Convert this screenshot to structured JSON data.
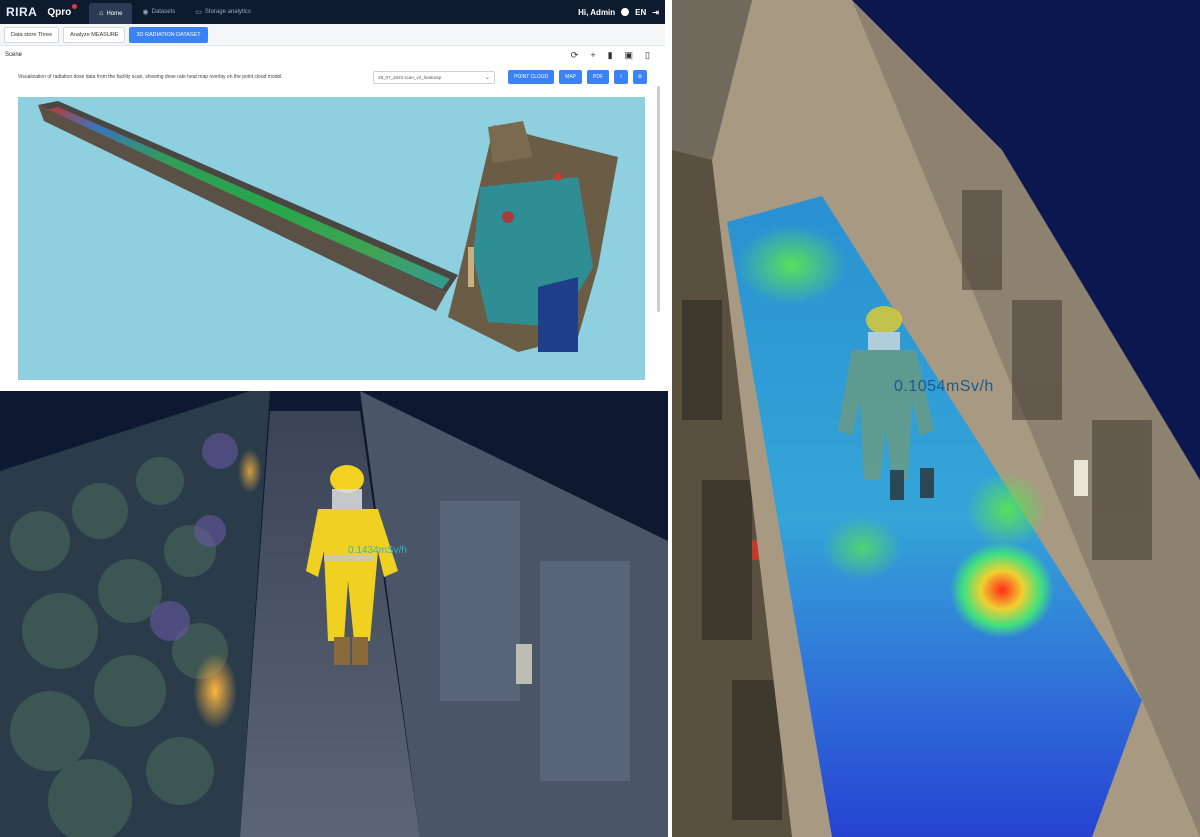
{
  "app": {
    "logo": "RIRA",
    "logo2": "Qpro",
    "nav": [
      {
        "icon": "home-icon",
        "label": "Home"
      },
      {
        "icon": "database-icon",
        "label": "Datasets"
      },
      {
        "icon": "folder-icon",
        "label": "Storage analytics"
      }
    ],
    "user": {
      "name": "Hi, Admin",
      "lang": "EN"
    },
    "tabs": [
      {
        "label": "Data store Three"
      },
      {
        "label": "Analyze MEASURE"
      },
      {
        "label": "3D RADIATION DATASET"
      }
    ],
    "section_title": "Scene",
    "toolbar_icons": [
      "refresh-icon",
      "plus-icon",
      "trash-icon",
      "save-icon",
      "export-icon"
    ],
    "description": "Visualization of radiation dose data from the facility scan, showing dose rate heat map overlay on the point cloud model.",
    "select_value": "28_07_2023 scan_v2_heatmap",
    "buttons": {
      "b1": "POINT CLOUD",
      "b2": "MAP",
      "b3": "PDF",
      "b4": "i",
      "b5": "⚙"
    },
    "scrollbar": "vertical-scrollbar",
    "accent": "#3b82f6",
    "viewer_bg": "#8ecfe0"
  },
  "scene_b": {
    "dose_label": "0.1434mSv/h",
    "bg": "#0e1830"
  },
  "scene_c": {
    "dose_label": "0.1054mSv/h",
    "bg": "#0c1750"
  }
}
